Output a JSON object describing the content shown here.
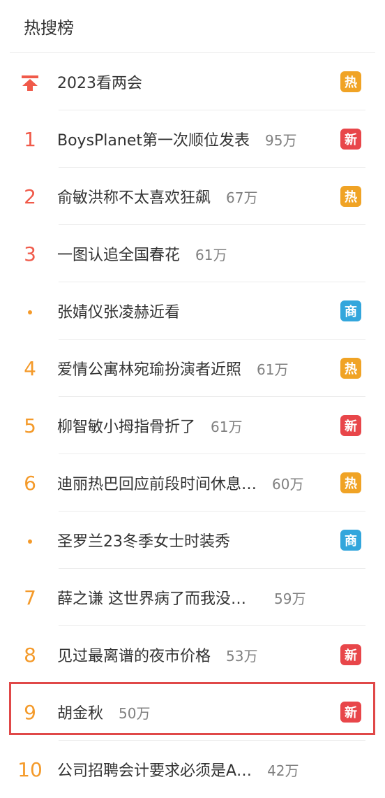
{
  "header": {
    "title": "热搜榜"
  },
  "colors": {
    "rank_top": "#f05a4a",
    "rank_other": "#f49a2a",
    "badge_hot": "#f0a325",
    "badge_new": "#e8464a",
    "badge_biz": "#33a6dc",
    "highlight_border": "#e04848"
  },
  "items": [
    {
      "rank": "",
      "icon": "pin-up-arrow-icon",
      "title": "2023看两会",
      "count": "",
      "badge": "热",
      "badge_type": "hot"
    },
    {
      "rank": "1",
      "title": "BoysPlanet第一次顺位发表",
      "count": "95万",
      "badge": "新",
      "badge_type": "new"
    },
    {
      "rank": "2",
      "title": "俞敏洪称不太喜欢狂飙",
      "count": "67万",
      "badge": "热",
      "badge_type": "hot"
    },
    {
      "rank": "3",
      "title": "一图认追全国春花",
      "count": "61万",
      "badge": "",
      "badge_type": ""
    },
    {
      "rank": "•",
      "title": "张婧仪张凌赫近看",
      "count": "",
      "badge": "商",
      "badge_type": "biz"
    },
    {
      "rank": "4",
      "title": "爱情公寓林宛瑜扮演者近照",
      "count": "61万",
      "badge": "热",
      "badge_type": "hot"
    },
    {
      "rank": "5",
      "title": "柳智敏小拇指骨折了",
      "count": "61万",
      "badge": "新",
      "badge_type": "new"
    },
    {
      "rank": "6",
      "title": "迪丽热巴回应前段时间休息…",
      "count": "60万",
      "badge": "热",
      "badge_type": "hot"
    },
    {
      "rank": "•",
      "title": "圣罗兰23冬季女士时装秀",
      "count": "",
      "badge": "商",
      "badge_type": "biz"
    },
    {
      "rank": "7",
      "title": "薛之谦 这世界病了而我没…",
      "count": "59万",
      "badge": "",
      "badge_type": ""
    },
    {
      "rank": "8",
      "title": "见过最离谱的夜市价格",
      "count": "53万",
      "badge": "新",
      "badge_type": "new"
    },
    {
      "rank": "9",
      "title": "胡金秋",
      "count": "50万",
      "badge": "新",
      "badge_type": "new"
    },
    {
      "rank": "10",
      "title": "公司招聘会计要求必须是A…",
      "count": "42万",
      "badge": "",
      "badge_type": ""
    }
  ]
}
